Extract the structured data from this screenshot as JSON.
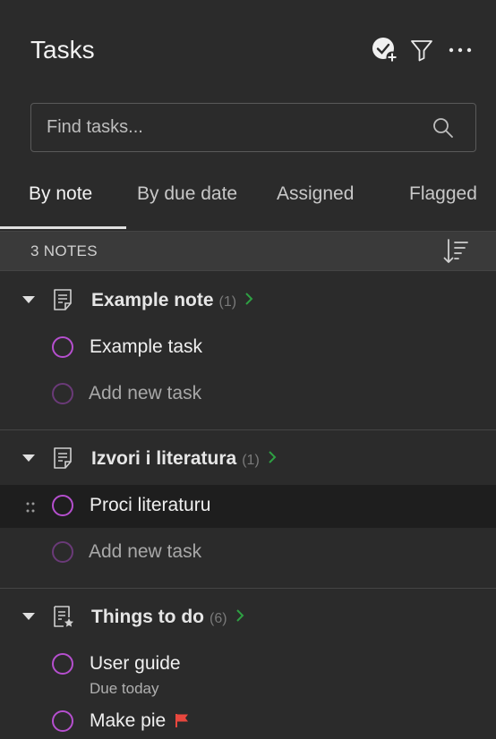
{
  "header": {
    "title": "Tasks"
  },
  "search": {
    "placeholder": "Find tasks..."
  },
  "tabs": [
    {
      "label": "By note",
      "active": true
    },
    {
      "label": "By due date",
      "active": false
    },
    {
      "label": "Assigned",
      "active": false
    },
    {
      "label": "Flagged",
      "active": false
    }
  ],
  "notes_bar": {
    "count_label": "3 NOTES"
  },
  "groups": [
    {
      "title": "Example note",
      "count": "(1)",
      "tasks": [
        {
          "label": "Example task"
        }
      ],
      "add_label": "Add new task"
    },
    {
      "title": "Izvori i literatura",
      "count": "(1)",
      "tasks": [
        {
          "label": "Proci literaturu"
        }
      ],
      "add_label": "Add new task"
    },
    {
      "title": "Things to do",
      "count": "(6)",
      "tasks": [
        {
          "label": "User guide",
          "due": "Due today"
        },
        {
          "label": "Make pie",
          "flagged": true
        }
      ]
    }
  ],
  "colors": {
    "background": "#2b2b2b",
    "accent_check": "#b64fcf",
    "chevron_green": "#2ea043",
    "flag_red": "#e8473e"
  }
}
